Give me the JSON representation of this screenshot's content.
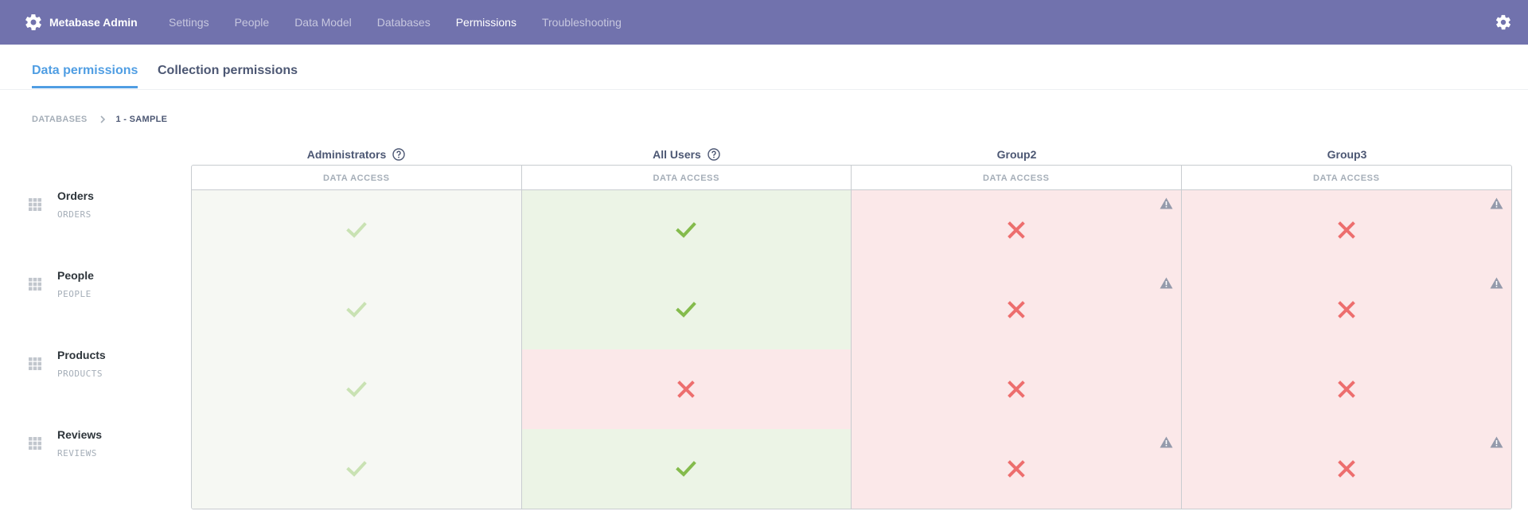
{
  "app": {
    "title": "Metabase Admin"
  },
  "nav": {
    "items": [
      {
        "label": "Settings",
        "active": false
      },
      {
        "label": "People",
        "active": false
      },
      {
        "label": "Data Model",
        "active": false
      },
      {
        "label": "Databases",
        "active": false
      },
      {
        "label": "Permissions",
        "active": true
      },
      {
        "label": "Troubleshooting",
        "active": false
      }
    ]
  },
  "tabs": [
    {
      "label": "Data permissions",
      "active": true
    },
    {
      "label": "Collection permissions",
      "active": false
    }
  ],
  "breadcrumb": {
    "root": "DATABASES",
    "current": "1 - SAMPLE"
  },
  "groups": [
    {
      "name": "Administrators",
      "help": true,
      "column_label": "DATA ACCESS"
    },
    {
      "name": "All Users",
      "help": true,
      "column_label": "DATA ACCESS"
    },
    {
      "name": "Group2",
      "help": false,
      "column_label": "DATA ACCESS"
    },
    {
      "name": "Group3",
      "help": false,
      "column_label": "DATA ACCESS"
    }
  ],
  "tables": [
    {
      "name": "Orders",
      "schema": "ORDERS",
      "permissions": [
        {
          "access": "all",
          "admin": true,
          "warning": false
        },
        {
          "access": "all",
          "admin": false,
          "warning": false
        },
        {
          "access": "none",
          "admin": false,
          "warning": true
        },
        {
          "access": "none",
          "admin": false,
          "warning": true
        }
      ]
    },
    {
      "name": "People",
      "schema": "PEOPLE",
      "permissions": [
        {
          "access": "all",
          "admin": true,
          "warning": false
        },
        {
          "access": "all",
          "admin": false,
          "warning": false
        },
        {
          "access": "none",
          "admin": false,
          "warning": true
        },
        {
          "access": "none",
          "admin": false,
          "warning": true
        }
      ]
    },
    {
      "name": "Products",
      "schema": "PRODUCTS",
      "permissions": [
        {
          "access": "all",
          "admin": true,
          "warning": false
        },
        {
          "access": "none",
          "admin": false,
          "warning": false
        },
        {
          "access": "none",
          "admin": false,
          "warning": false
        },
        {
          "access": "none",
          "admin": false,
          "warning": false
        }
      ]
    },
    {
      "name": "Reviews",
      "schema": "REVIEWS",
      "permissions": [
        {
          "access": "all",
          "admin": true,
          "warning": false
        },
        {
          "access": "all",
          "admin": false,
          "warning": false
        },
        {
          "access": "none",
          "admin": false,
          "warning": true
        },
        {
          "access": "none",
          "admin": false,
          "warning": true
        }
      ]
    }
  ],
  "colors": {
    "nav_bg": "#7172ad",
    "brand_blue": "#509ee3",
    "granted_green": "#84bb4c",
    "admin_green_faded": "#c9e2b3",
    "denied_red": "#ed6e6e",
    "warning_gray": "#949aab"
  },
  "icons": {
    "brand": "gear-icon",
    "settings": "gear-icon",
    "breadcrumb_separator": "chevron-right-icon",
    "help": "question-circle-icon",
    "table": "table-grid-icon",
    "granted": "check-icon",
    "denied": "close-icon",
    "warning": "warning-triangle-icon"
  }
}
